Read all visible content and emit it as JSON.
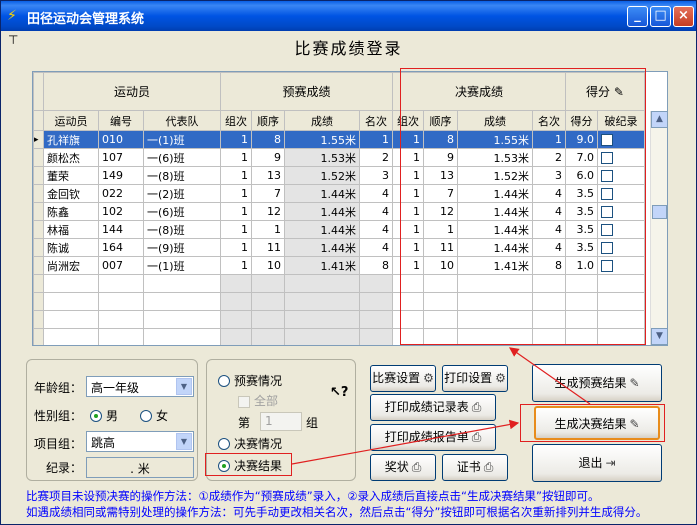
{
  "window": {
    "title": "田径运动会管理系统",
    "min": "_",
    "max": "□",
    "close": "×"
  },
  "form_title": "比赛成绩登录",
  "table": {
    "groups": {
      "athlete": "运动员",
      "prelim": "预赛成绩",
      "final": "决赛成绩",
      "points": "得分"
    },
    "columns": [
      "运动员",
      "编号",
      "代表队",
      "组次",
      "顺序",
      "成绩",
      "名次",
      "组次",
      "顺序",
      "成绩",
      "名次",
      "得分",
      "破纪录"
    ],
    "rows": [
      [
        "孔祥旗",
        "010",
        "一(1)班",
        "1",
        "8",
        "1.55米",
        "1",
        "1",
        "8",
        "1.55米",
        "1",
        "9.0"
      ],
      [
        "颜松杰",
        "107",
        "一(6)班",
        "1",
        "9",
        "1.53米",
        "2",
        "1",
        "9",
        "1.53米",
        "2",
        "7.0"
      ],
      [
        "董荣",
        "149",
        "一(8)班",
        "1",
        "13",
        "1.52米",
        "3",
        "1",
        "13",
        "1.52米",
        "3",
        "6.0"
      ],
      [
        "金回钦",
        "022",
        "一(2)班",
        "1",
        "7",
        "1.44米",
        "4",
        "1",
        "7",
        "1.44米",
        "4",
        "3.5"
      ],
      [
        "陈鑫",
        "102",
        "一(6)班",
        "1",
        "12",
        "1.44米",
        "4",
        "1",
        "12",
        "1.44米",
        "4",
        "3.5"
      ],
      [
        "林福",
        "144",
        "一(8)班",
        "1",
        "1",
        "1.44米",
        "4",
        "1",
        "1",
        "1.44米",
        "4",
        "3.5"
      ],
      [
        "陈诚",
        "164",
        "一(9)班",
        "1",
        "11",
        "1.44米",
        "4",
        "1",
        "11",
        "1.44米",
        "4",
        "3.5"
      ],
      [
        "尚洲宏",
        "007",
        "一(1)班",
        "1",
        "10",
        "1.41米",
        "8",
        "1",
        "10",
        "1.41米",
        "8",
        "1.0"
      ]
    ],
    "selected_row": 0,
    "current_row_marker": "▸"
  },
  "filters": {
    "age_group_label": "年龄组：",
    "age_group_value": "高一年级",
    "gender_label": "性别组：",
    "gender_male": "男",
    "gender_female": "女",
    "gender_selected": "男",
    "event_label": "项目组：",
    "event_value": "跳高",
    "record_label": "纪录：",
    "record_value": ". 米"
  },
  "mode": {
    "prelim_status": "预赛情况",
    "all": "全部",
    "group_prefix": "第",
    "group_value": "1",
    "group_suffix": "组",
    "final_status": "决赛情况",
    "final_result": "决赛结果",
    "selected": "决赛结果"
  },
  "buttons": {
    "match_settings": "比赛设置",
    "print_settings": "打印设置",
    "print_record_sheet": "打印成绩记录表",
    "print_report_sheet": "打印成绩报告单",
    "certificate": "奖状",
    "diploma": "证书",
    "gen_prelim": "生成预赛结果",
    "gen_final": "生成决赛结果",
    "exit": "退出"
  },
  "notes": [
    "比赛项目未设预决赛的操作方法：①成绩作为“预赛成绩”录入，②录入成绩后直接点击“生成决赛结果”按钮即可。",
    "如遇成绩相同或需特别处理的操作方法：可先手动更改相关名次，然后点击“得分”按钮即可根据名次重新排列并生成得分。"
  ],
  "colors": {
    "annotation": "#E02020",
    "note_text": "#0000FF",
    "selection": "#316AC5",
    "titlebar": "#0054E3"
  }
}
